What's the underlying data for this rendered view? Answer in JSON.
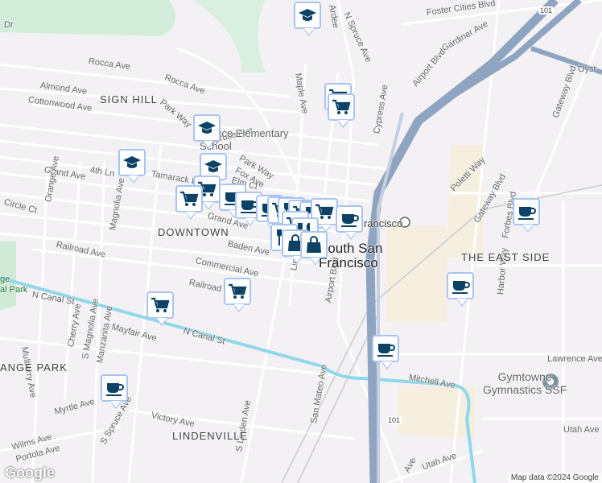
{
  "labels": [
    "Foster Cities Blvd",
    "Ardee",
    "N Spruce Ave",
    "Gardiner Ave",
    "Airport Blvd",
    "Oyst",
    "Rocca Ave",
    "Almond Ave",
    "Cottonwood Ave",
    "Rocca Ave",
    "Park Way",
    "Maple Ave",
    "Cypress Ave",
    "Gateway Blvd",
    "Spruce Ave",
    "Tamarack Ln",
    "Park Way",
    "4th Ln",
    "Grand Ave",
    "Orange Ave",
    "Magnolia Ave",
    "Poletti Way",
    "Gateway Blvd",
    "Circle Ct",
    "Baden Ave",
    "Railroad Ave",
    "Commercial Ave",
    "Forbes Blvd",
    "Harbor Way",
    "Railroad",
    "Linden Ave",
    "Airport Blvd",
    "N Canal St",
    "Mayfair Ave",
    "N Canal St",
    "Mulberry Ave",
    "Cherry Ave",
    "S Magnolia Ave",
    "Manzanita Ave",
    "Mitchell Ave",
    "Lawrence Ave",
    "San Mateo Ave",
    "Myrtle Ave",
    "Victory Ave",
    "Utah Ave",
    "Wilms Ave",
    "Portola Ave",
    "S Spruce Ave",
    "S Linden Ave",
    "Utah Ave",
    "Dr",
    "Grand Ave",
    "Elm Ct",
    "Fox Ave",
    "Ave"
  ],
  "areas": {
    "sign_hill": "SIGN HILL",
    "downtown": "DOWNTOWN",
    "east_side": "THE EAST SIDE",
    "lindenville": "LINDENVILLE",
    "orange_park": "ANGE PARK",
    "orange_park2": "ge",
    "orange_park3": "al Park"
  },
  "city": "South San\nFrancisco",
  "station": "rancisco",
  "school_label": "Spruce Elementary\nSchool",
  "poi": "Gymtowne\nGymnastics SSF",
  "highway": "101",
  "attribution": "Map data ©2024 Google",
  "logo": "Google",
  "colors": {
    "highway": "#8fa4c0",
    "canal": "#8fd8ea",
    "marker_icon": "#0b4266",
    "marker_border": "#a9c4f2"
  }
}
